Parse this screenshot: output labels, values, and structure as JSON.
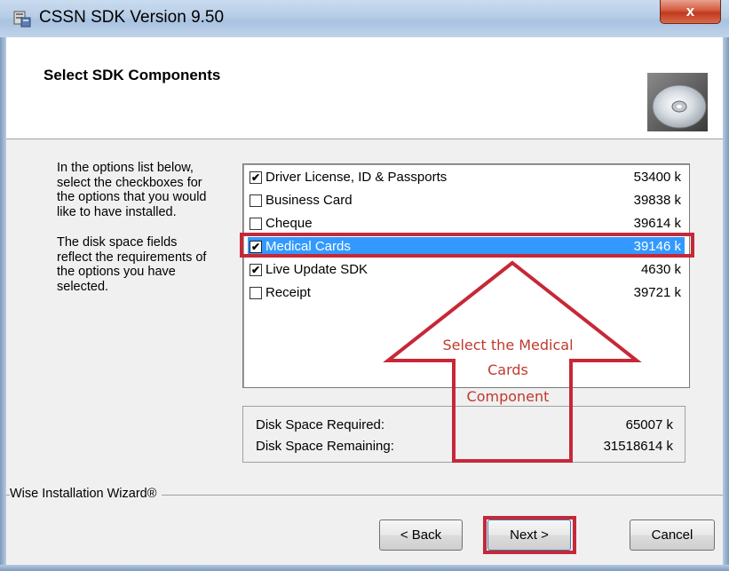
{
  "window": {
    "title": "CSSN SDK Version 9.50",
    "close_label": "x"
  },
  "header": {
    "title": "Select SDK Components"
  },
  "description": {
    "paragraph1": "In the options list below, select the checkboxes for the options that you would like to have installed.",
    "paragraph2": "The disk space fields reflect the requirements of the options you have selected."
  },
  "components": [
    {
      "label": "Driver License, ID & Passports",
      "size": "53400 k",
      "checked": true
    },
    {
      "label": "Business Card",
      "size": "39838 k",
      "checked": false
    },
    {
      "label": "Cheque",
      "size": "39614 k",
      "checked": false
    },
    {
      "label": "Medical Cards",
      "size": "39146 k",
      "checked": true,
      "selected": true
    },
    {
      "label": "Live Update SDK",
      "size": "4630 k",
      "checked": true
    },
    {
      "label": "Receipt",
      "size": "39721 k",
      "checked": false
    }
  ],
  "disk_space": {
    "required_label": "Disk Space Required:",
    "required_value": "65007 k",
    "remaining_label": "Disk Space Remaining:",
    "remaining_value": "31518614 k"
  },
  "brand": "Wise Installation Wizard®",
  "buttons": {
    "back": "< Back",
    "next": "Next >",
    "cancel": "Cancel"
  },
  "annotation": {
    "line1": "Select the Medical",
    "line2": "Cards",
    "line3": "Component"
  },
  "colors": {
    "highlight": "#3399ff",
    "annotation_red": "#c62837"
  }
}
